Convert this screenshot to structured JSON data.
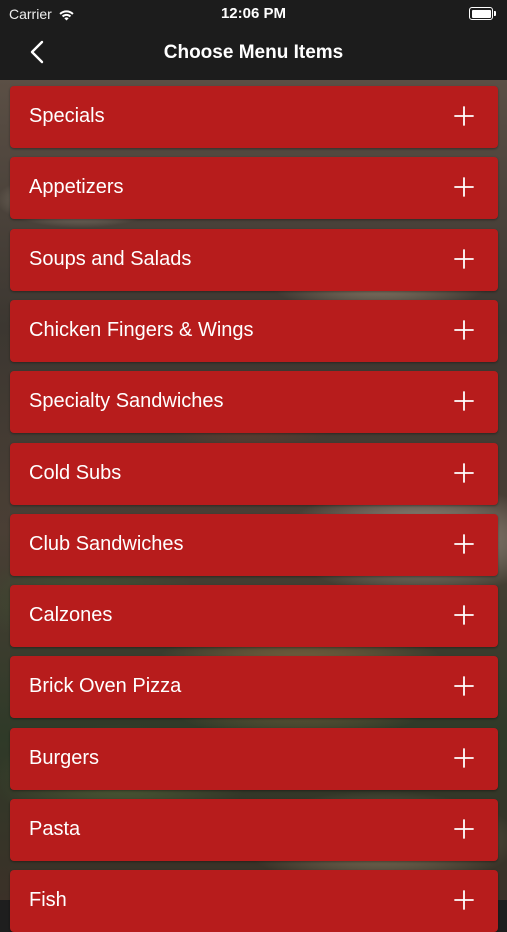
{
  "status_bar": {
    "carrier": "Carrier",
    "time": "12:06 PM"
  },
  "nav": {
    "title": "Choose Menu Items",
    "back_icon": "chevron-left-icon"
  },
  "menu": {
    "add_icon": "plus-icon",
    "items": [
      {
        "label": "Specials"
      },
      {
        "label": "Appetizers"
      },
      {
        "label": "Soups and Salads"
      },
      {
        "label": "Chicken Fingers & Wings"
      },
      {
        "label": "Specialty Sandwiches"
      },
      {
        "label": "Cold Subs"
      },
      {
        "label": "Club Sandwiches"
      },
      {
        "label": "Calzones"
      },
      {
        "label": "Brick Oven Pizza"
      },
      {
        "label": "Burgers"
      },
      {
        "label": "Pasta"
      },
      {
        "label": "Fish"
      }
    ]
  },
  "colors": {
    "accent": "#b71c1c",
    "bar": "#1c1c1c"
  }
}
